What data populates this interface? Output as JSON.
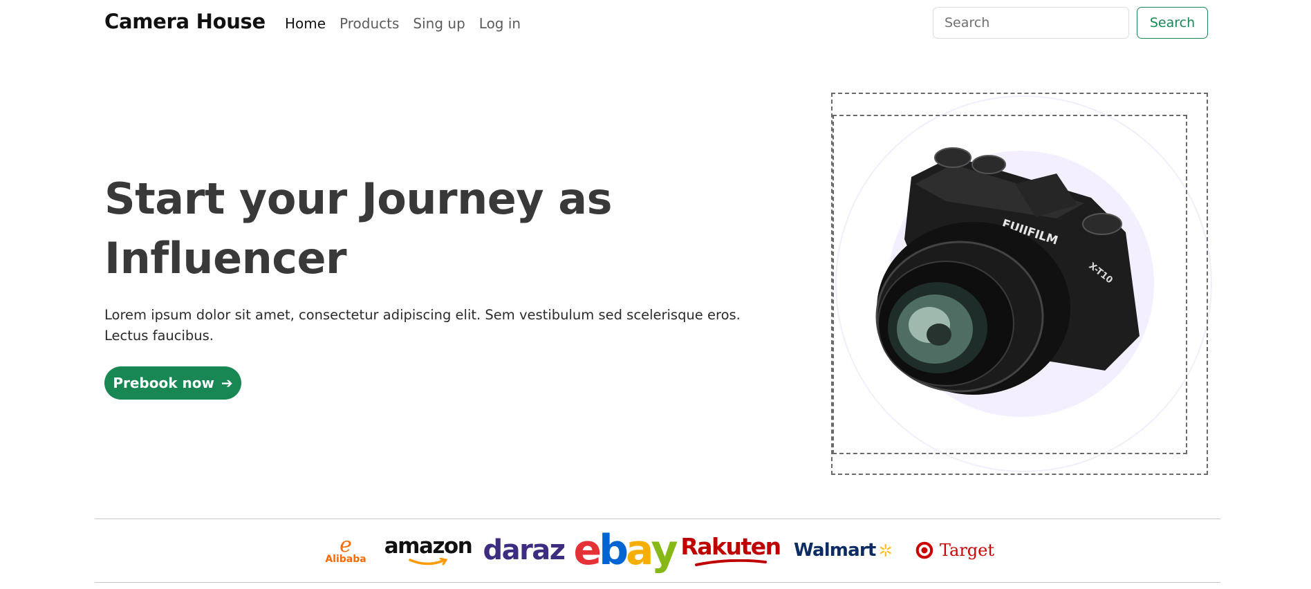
{
  "navbar": {
    "brand": "Camera House",
    "links": [
      {
        "label": "Home",
        "active": true
      },
      {
        "label": "Products",
        "active": false
      },
      {
        "label": "Sing up",
        "active": false
      },
      {
        "label": "Log in",
        "active": false
      }
    ],
    "search": {
      "placeholder": "Search",
      "value": "",
      "button_label": "Search"
    }
  },
  "hero": {
    "title_line1": "Start your Journey as",
    "title_line2": "Influencer",
    "description_line1": "Lorem ipsum dolor sit amet, consectetur adipiscing elit. Sem vestibulum sed scelerisque eros.",
    "description_line2": "Lectus faucibus.",
    "cta_label": "Prebook now",
    "cta_icon": "arrow-right-icon",
    "image": {
      "subject": "camera-image",
      "camera_brand_text": "FUJIFILM",
      "camera_model_text": "X-T10"
    }
  },
  "partners": {
    "alibaba": {
      "name": "Alibaba",
      "mark": "e"
    },
    "amazon": {
      "name": "amazon"
    },
    "daraz": {
      "name": "daraz"
    },
    "ebay": {
      "letters": [
        "e",
        "b",
        "a",
        "y"
      ]
    },
    "rakuten": {
      "name": "Rakuten"
    },
    "walmart": {
      "name": "Walmart"
    },
    "target": {
      "name": "Target"
    }
  },
  "colors": {
    "accent": "#198754",
    "heading": "#393939",
    "hero_blob": "#f3efff",
    "ebay_e": "#e53238",
    "ebay_b": "#0064d2",
    "ebay_a": "#f5af02",
    "ebay_y": "#86b817",
    "walmart_spark": "#ffc220"
  }
}
